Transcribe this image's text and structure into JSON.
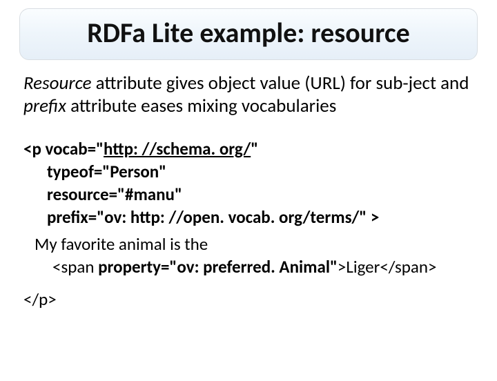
{
  "title": "RDFa Lite example: resource",
  "intro": {
    "w1": "Resource",
    "t1": " attribute gives object value (URL) for sub-ject and ",
    "w2": "prefix",
    "t2": " attribute eases mixing vocabularies"
  },
  "code": {
    "l1a": "<p vocab=\"",
    "l1b": "http: //schema. org/",
    "l1c": "\"",
    "l2": "typeof=\"Person\"",
    "l3": "resource=\"#manu\"",
    "l4": "prefix=\"ov: http: //open. vocab. org/terms/\" >",
    "l5": "My favorite animal is the",
    "l6a": "<span ",
    "l6b": "property=\"ov: preferred. Animal\"",
    "l6c": ">Liger</span>",
    "l7": "</p>"
  }
}
